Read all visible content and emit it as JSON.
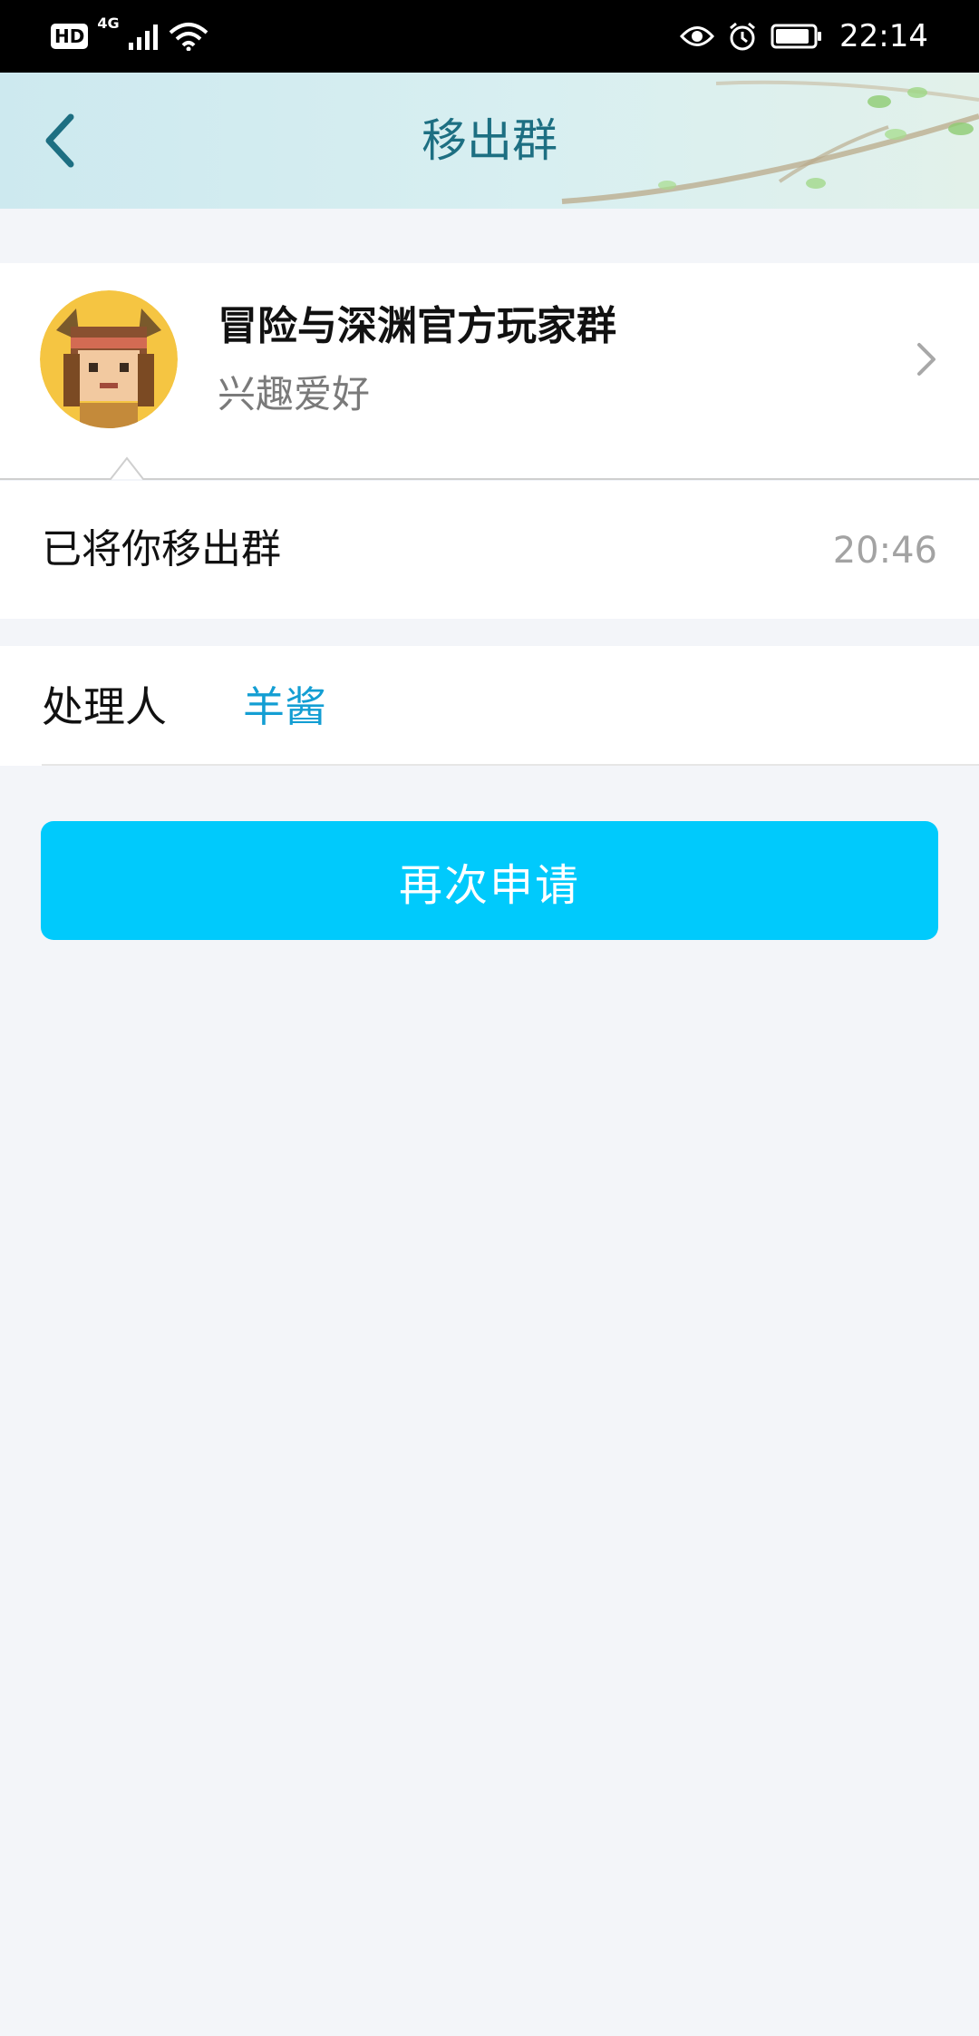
{
  "status_bar": {
    "hd_label": "HD",
    "network_label": "4G",
    "time": "22:14",
    "icons": [
      "signal-icon",
      "wifi-icon",
      "eye-icon",
      "alarm-icon",
      "battery-icon"
    ]
  },
  "header": {
    "title": "移出群",
    "back_icon": "chevron-left-icon"
  },
  "group": {
    "name": "冒险与深渊官方玩家群",
    "category": "兴趣爱好"
  },
  "notice": {
    "text": "已将你移出群",
    "time": "20:46"
  },
  "handler": {
    "label": "处理人",
    "name": "羊酱"
  },
  "actions": {
    "reapply_label": "再次申请"
  },
  "colors": {
    "accent": "#00cafc",
    "title_text": "#1d6f82",
    "link": "#139ed3",
    "background": "#f3f5f9"
  }
}
